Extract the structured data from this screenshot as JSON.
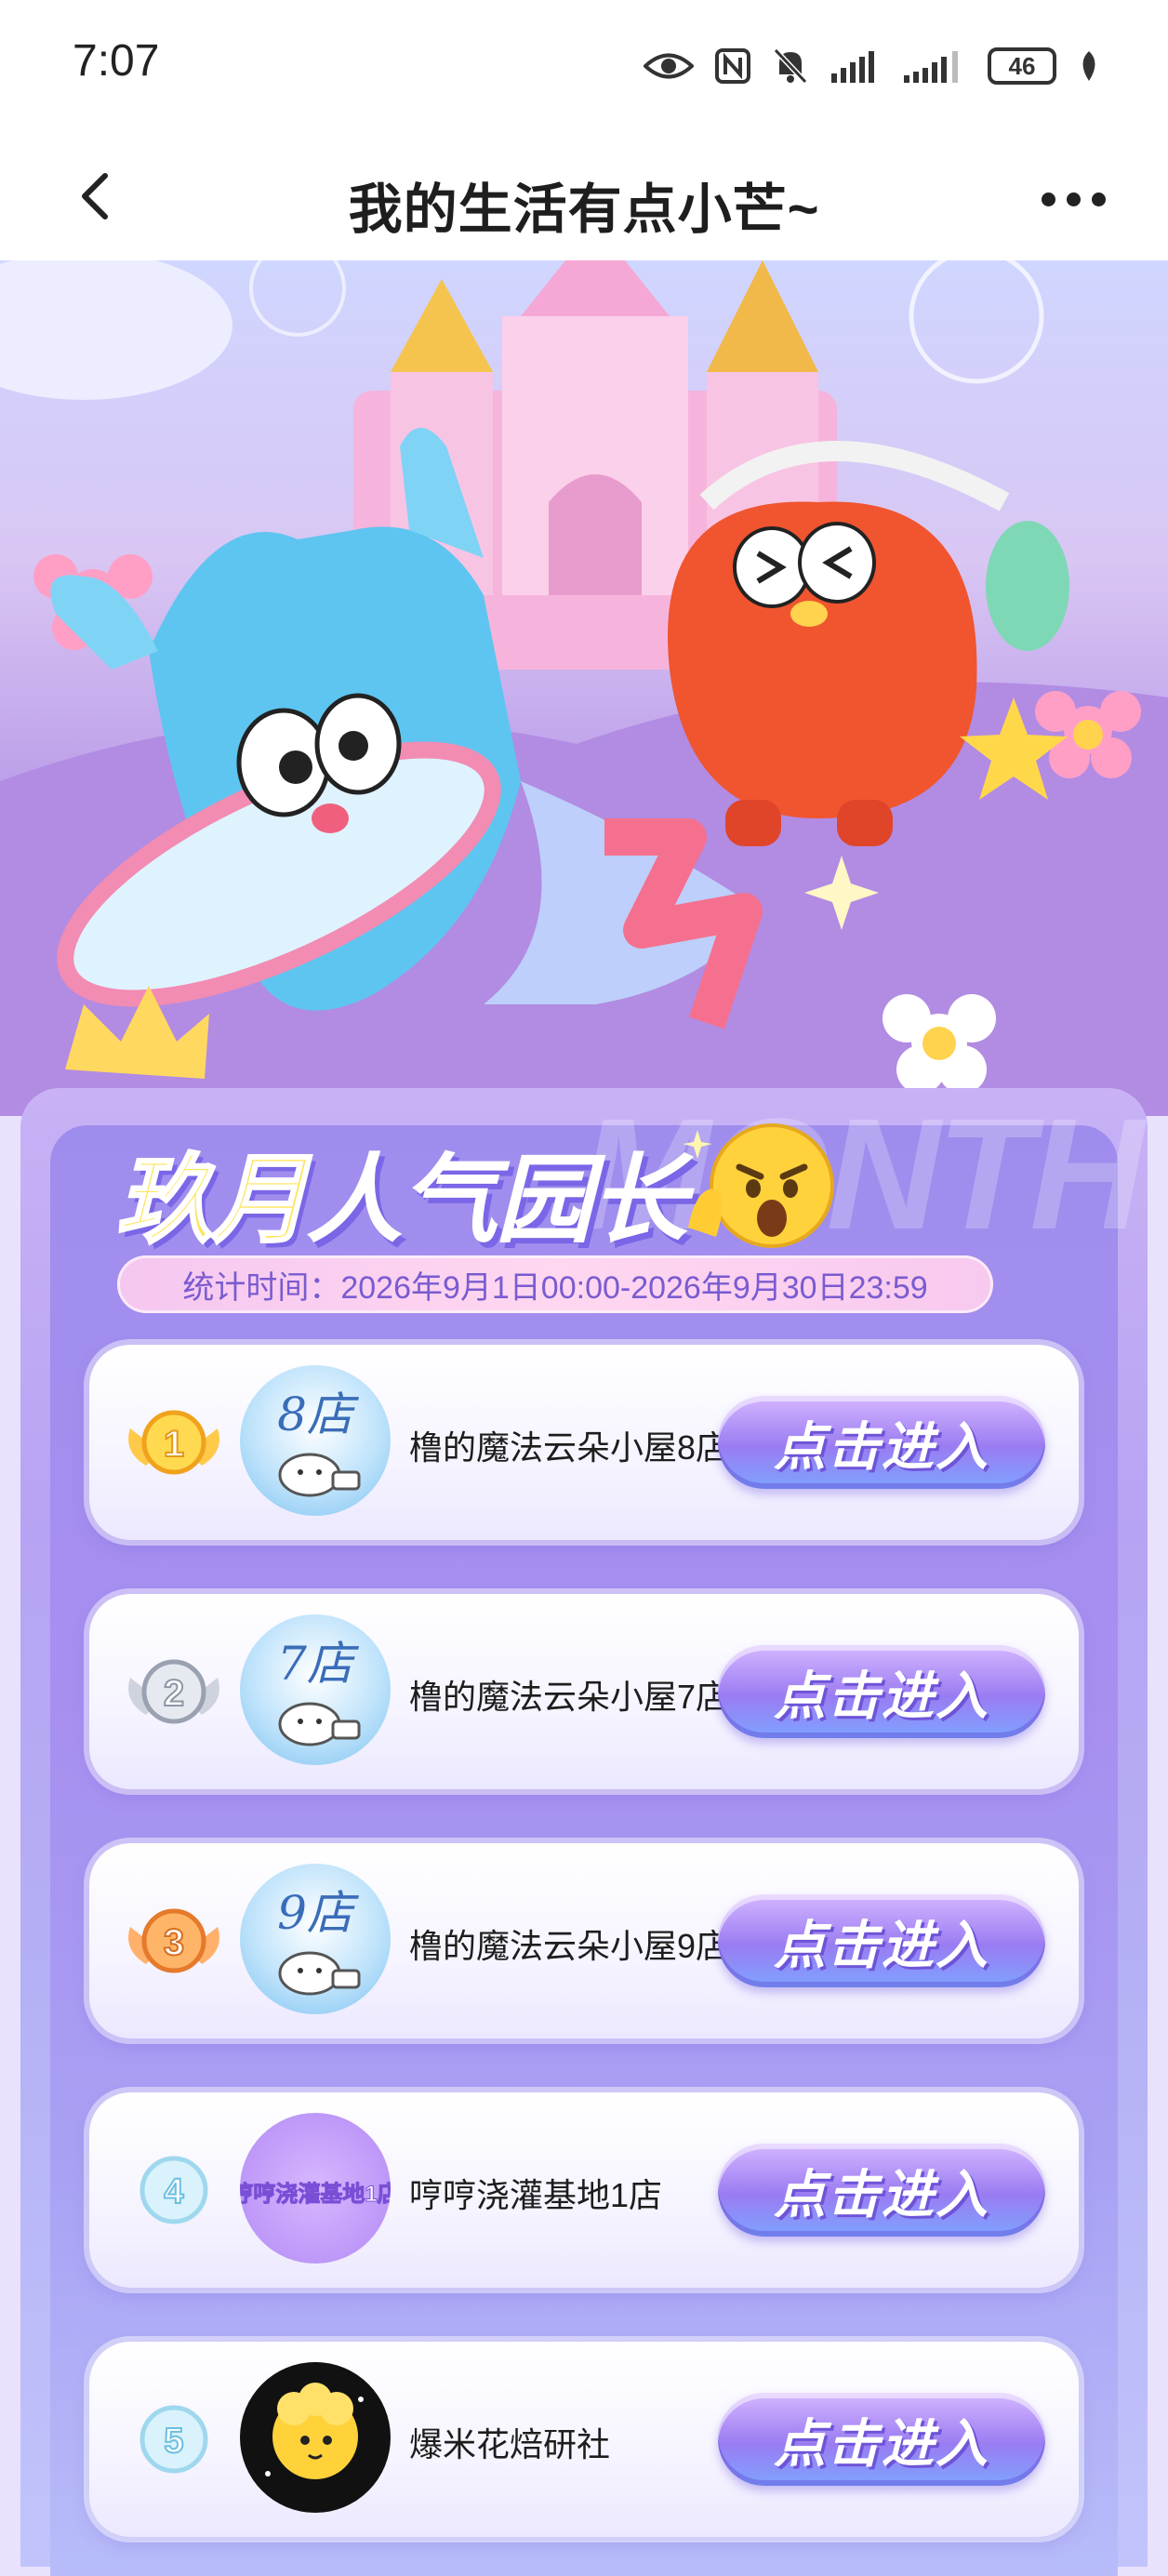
{
  "status_bar": {
    "time": "7:07",
    "battery": "46"
  },
  "header": {
    "title": "我的生活有点小芒~"
  },
  "colors": {
    "accent": "#9a7cf2",
    "title_yellow": "#ffe35a",
    "panel": "#a78ff0"
  },
  "ranking": {
    "title_part1": "玖月",
    "title_part2": "人气园长",
    "watermark": "MONTH",
    "period": "统计时间：2026年9月1日00:00-2026年9月30日23:59",
    "items": [
      {
        "rank": "1",
        "avatar_text": "8店",
        "name": "橹的魔法云朵小屋8店",
        "button": "点击进入"
      },
      {
        "rank": "2",
        "avatar_text": "7店",
        "name": "橹的魔法云朵小屋7店",
        "button": "点击进入"
      },
      {
        "rank": "3",
        "avatar_text": "9店",
        "name": "橹的魔法云朵小屋9店",
        "button": "点击进入"
      },
      {
        "rank": "4",
        "avatar_text": "哼哼浇灌基地1店",
        "name": "哼哼浇灌基地1店",
        "button": "点击进入"
      },
      {
        "rank": "5",
        "avatar_text": "",
        "name": "爆米花焙研社",
        "button": "点击进入"
      }
    ]
  }
}
